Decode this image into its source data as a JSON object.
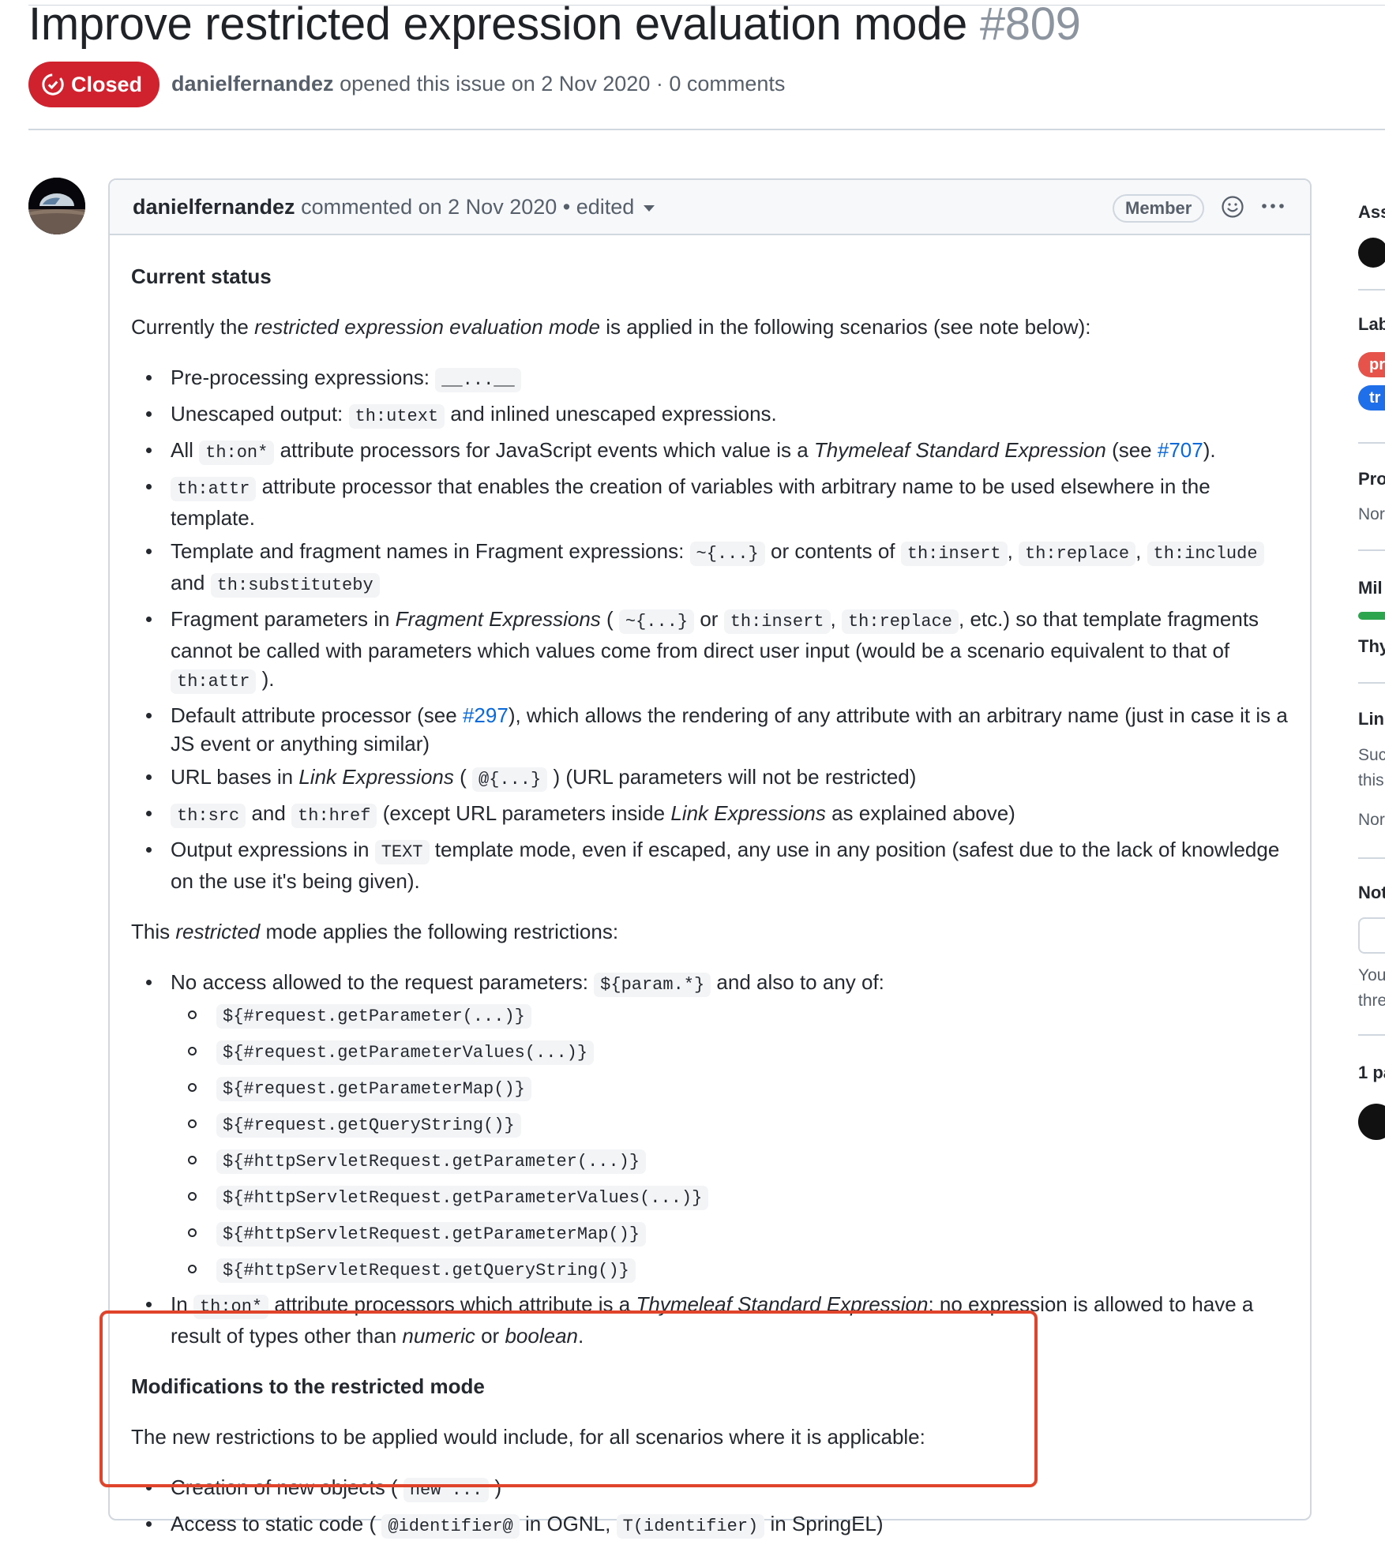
{
  "issue": {
    "title": "Improve restricted expression evaluation mode",
    "number": "#809",
    "state": "Closed",
    "author": "danielfernandez",
    "meta_rest": "opened this issue on 2 Nov 2020 · 0 comments"
  },
  "comment": {
    "author": "danielfernandez",
    "meta": "commented on 2 Nov 2020 • edited",
    "badge": "Member"
  },
  "body": {
    "h_current_status": "Current status",
    "p1": {
      "a": "Currently the ",
      "em": "restricted expression evaluation mode",
      "b": " is applied in the following scenarios (see note below):"
    },
    "list1": {
      "i1": {
        "text": "Pre-processing expressions: ",
        "code": "__...__"
      },
      "i2": {
        "a": "Unescaped output: ",
        "code": "th:utext",
        "b": " and inlined unescaped expressions."
      },
      "i3": {
        "a": "All ",
        "code": "th:on*",
        "b": " attribute processors for JavaScript events which value is a ",
        "em": "Thymeleaf Standard Expression",
        "c": " (see ",
        "link": "#707",
        "d": ")."
      },
      "i4": {
        "code": "th:attr",
        "b": " attribute processor that enables the creation of variables with arbitrary name to be used elsewhere in the template."
      },
      "i5": {
        "a": "Template and fragment names in Fragment expressions: ",
        "code1": "~{...}",
        "b": " or contents of ",
        "code2": "th:insert",
        "c": ", ",
        "code3": "th:replace",
        "d": ", ",
        "code4": "th:include",
        "e": " and ",
        "code5": "th:substituteby"
      },
      "i6": {
        "a": "Fragment parameters in ",
        "em": "Fragment Expressions",
        "b": " ( ",
        "code1": "~{...}",
        "c": " or ",
        "code2": "th:insert",
        "d": ", ",
        "code3": "th:replace",
        "e": ", etc.) so that template fragments cannot be called with parameters which values come from direct user input (would be a scenario equivalent to that of ",
        "code4": "th:attr",
        "f": " )."
      },
      "i7": {
        "a": "Default attribute processor (see ",
        "link": "#297",
        "b": "), which allows the rendering of any attribute with an arbitrary name (just in case it is a JS event or anything similar)"
      },
      "i8": {
        "a": "URL bases in ",
        "em": "Link Expressions",
        "b": " ( ",
        "code": "@{...}",
        "c": " ) (URL parameters will not be restricted)"
      },
      "i9": {
        "code1": "th:src",
        "a": " and ",
        "code2": "th:href",
        "b": " (except URL parameters inside ",
        "em": "Link Expressions",
        "c": " as explained above)"
      },
      "i10": {
        "a": "Output expressions in ",
        "code": "TEXT",
        "b": " template mode, even if escaped, any use in any position (safest due to the lack of knowledge on the use it's being given)."
      }
    },
    "p2": {
      "a": "This ",
      "em": "restricted",
      "b": " mode applies the following restrictions:"
    },
    "list2": {
      "i1": {
        "a": "No access allowed to the request parameters: ",
        "code": "${param.*}",
        "b": " and also to any of:"
      },
      "sub": [
        "${#request.getParameter(...)}",
        "${#request.getParameterValues(...)}",
        "${#request.getParameterMap()}",
        "${#request.getQueryString()}",
        "${#httpServletRequest.getParameter(...)}",
        "${#httpServletRequest.getParameterValues(...)}",
        "${#httpServletRequest.getParameterMap()}",
        "${#httpServletRequest.getQueryString()}"
      ],
      "i2": {
        "a": "In ",
        "code": "th:on*",
        "b": " attribute processors which attribute is a ",
        "em1": "Thymeleaf Standard Expression",
        "c": ": no expression is allowed to have a result of types other than ",
        "em2": "numeric",
        "d": " or ",
        "em3": "boolean",
        "e": "."
      }
    },
    "h_modifications": "Modifications to the restricted mode",
    "p3": "The new restrictions to be applied would include, for all scenarios where it is applicable:",
    "list3": {
      "i1": {
        "a": "Creation of new objects ( ",
        "code": "new ...",
        "b": " )"
      },
      "i2": {
        "a": "Access to static code ( ",
        "code1": "@identifier@",
        "b": " in OGNL, ",
        "code2": "T(identifier)",
        "c": " in SpringEL)"
      }
    }
  },
  "sidebar": {
    "assignees": "Ass",
    "labels": "Lab",
    "label1": "pr",
    "label2": "tr",
    "projects": "Pro",
    "projects_value": "Nor",
    "milestone": "Mil",
    "milestone_name": "Thy",
    "linked": "Lin",
    "linked_text1": "Suc",
    "linked_text2": "this",
    "linked_value": "Nor",
    "notifications": "Not",
    "notif_text1": "You",
    "notif_text2": "thre",
    "participants": "1 pa"
  },
  "colors": {
    "closed": "#cf222e",
    "link": "#0969da",
    "highlight": "#e0452b",
    "milestone": "#2da44e"
  }
}
